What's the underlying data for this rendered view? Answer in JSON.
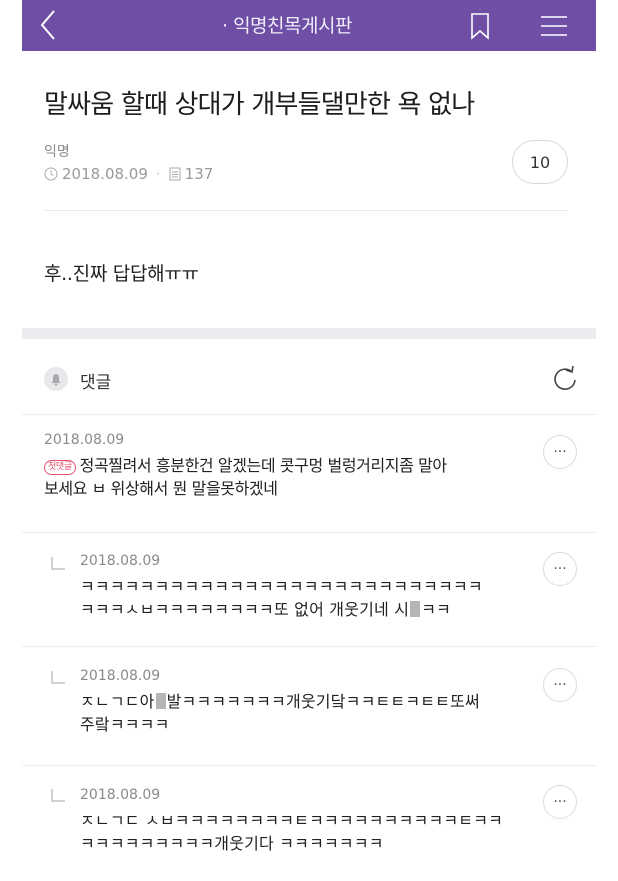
{
  "header": {
    "board_title": "· 익명친목게시판",
    "accent": "#6f4fa6"
  },
  "post": {
    "title": "말싸움 할때 상대가 개부들댈만한 욕 없나",
    "author": "익명",
    "date": "2018.08.09",
    "views": "137",
    "comment_count": "10",
    "body": "후..진짜 답답해ㅠㅠ"
  },
  "comments_section": {
    "label": "댓글"
  },
  "comments": [
    {
      "date": "2018.08.09",
      "badge": "첫댓글",
      "line1": "정곡찔려서 흥분한건 알겠는데 콧구멍 벌렁거리지좀 말아",
      "line2": "보세요 ㅂ 위상해서 뭔 말을못하겠네"
    }
  ],
  "replies": [
    {
      "date": "2018.08.09",
      "line1": "ㅋㅋㅋㅋㅋㅋㅋㅋㅋㅋㅋㅋㅋㅋㅋㅋㅋㅋㅋㅋㅋㅋㅋㅋㅋㅋㅋ",
      "line2_a": "ㅋㅋㅋㅅㅂㅋㅋㅋㅋㅋㅋㅋㅋ또 없어 개웃기네 시",
      "line2_b": "ㅋㅋ"
    },
    {
      "date": "2018.08.09",
      "line1_a": "ㅈㄴㄱㄷ아",
      "line1_b": "발ㅋㅋㅋㅋㅋㅋㅋ개웃기닼ㅋㅋㅌㅌㅋㅌㅌ또써",
      "line2": "주랔ㅋㅋㅋㅋ"
    },
    {
      "date": "2018.08.09",
      "line1": "ㅈㄴㄱㄷ ㅅㅂㅋㅋㅋㅋㅋㅋㅋㅋㅌㅋㅋㅋㅋㅋㅋㅋㅋㅋㅋㅌㅋㅋ",
      "line2": "ㅋㅋㅋㅋㅋㅋㅋㅋㅋ개웃기다 ㅋㅋㅋㅋㅋㅋㅋ"
    }
  ],
  "icons": {
    "back": "chevron-left-icon",
    "bookmark": "bookmark-icon",
    "menu": "hamburger-menu-icon",
    "refresh": "refresh-icon",
    "more": "more-icon"
  }
}
